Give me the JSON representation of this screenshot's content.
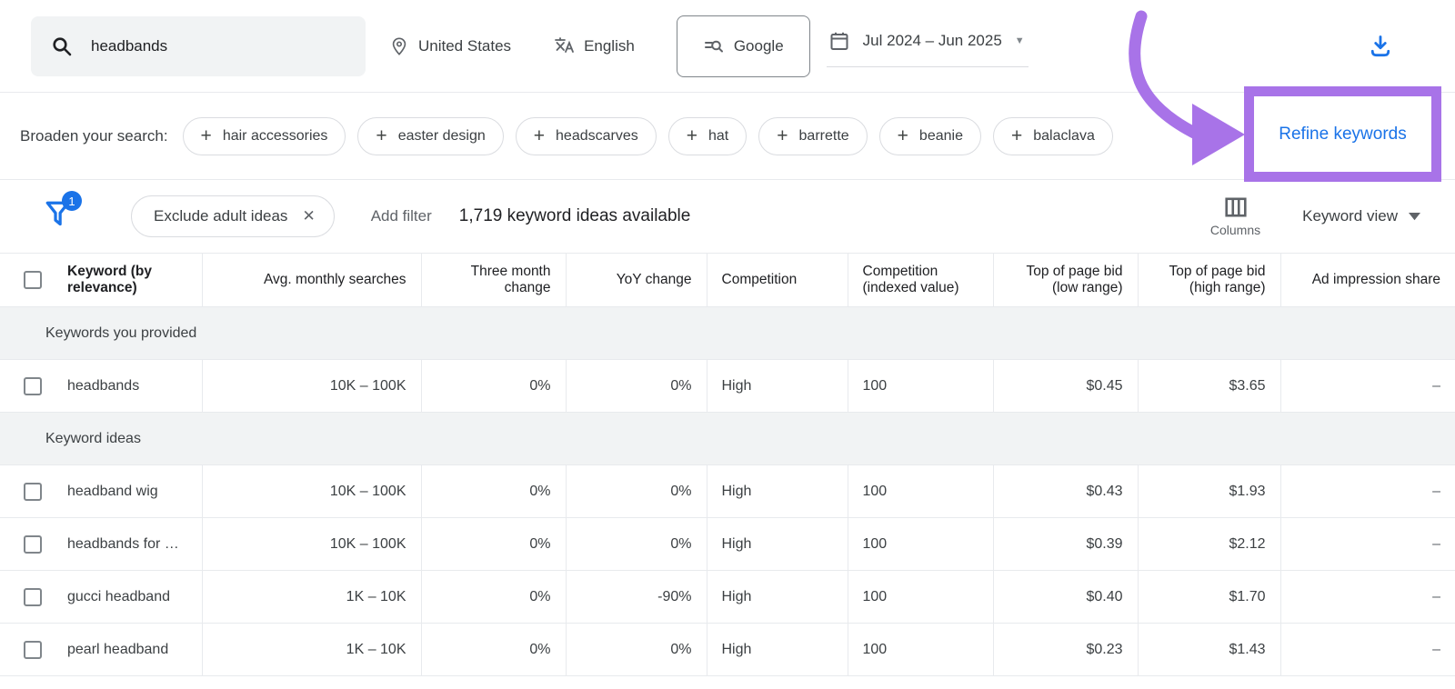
{
  "topbar": {
    "search_value": "headbands",
    "location": "United States",
    "language": "English",
    "network": "Google",
    "date_range": "Jul 2024 – Jun 2025"
  },
  "broaden": {
    "label": "Broaden your search:",
    "chips": [
      "hair accessories",
      "easter design",
      "headscarves",
      "hat",
      "barrette",
      "beanie",
      "balaclava"
    ],
    "refine_button": "Refine keywords"
  },
  "filterbar": {
    "filter_badge_count": "1",
    "active_filter": "Exclude adult ideas",
    "add_filter_label": "Add filter",
    "ideas_count": "1,719 keyword ideas available",
    "columns_label": "Columns",
    "view_selector": "Keyword view"
  },
  "table": {
    "headers": [
      "Keyword (by relevance)",
      "Avg. monthly searches",
      "Three month change",
      "YoY change",
      "Competition",
      "Competition (indexed value)",
      "Top of page bid (low range)",
      "Top of page bid (high range)",
      "Ad impression share"
    ],
    "sections": [
      {
        "label": "Keywords you provided",
        "rows": [
          [
            "headbands",
            "10K – 100K",
            "0%",
            "0%",
            "High",
            "100",
            "$0.45",
            "$3.65",
            "–"
          ]
        ]
      },
      {
        "label": "Keyword ideas",
        "rows": [
          [
            "headband wig",
            "10K – 100K",
            "0%",
            "0%",
            "High",
            "100",
            "$0.43",
            "$1.93",
            "–"
          ],
          [
            "headbands for …",
            "10K – 100K",
            "0%",
            "0%",
            "High",
            "100",
            "$0.39",
            "$2.12",
            "–"
          ],
          [
            "gucci headband",
            "1K – 10K",
            "0%",
            "-90%",
            "High",
            "100",
            "$0.40",
            "$1.70",
            "–"
          ],
          [
            "pearl headband",
            "1K – 10K",
            "0%",
            "0%",
            "High",
            "100",
            "$0.23",
            "$1.43",
            "–"
          ]
        ]
      }
    ]
  },
  "colors": {
    "annotation_purple": "#a873e8",
    "link_blue": "#1a73e8"
  }
}
